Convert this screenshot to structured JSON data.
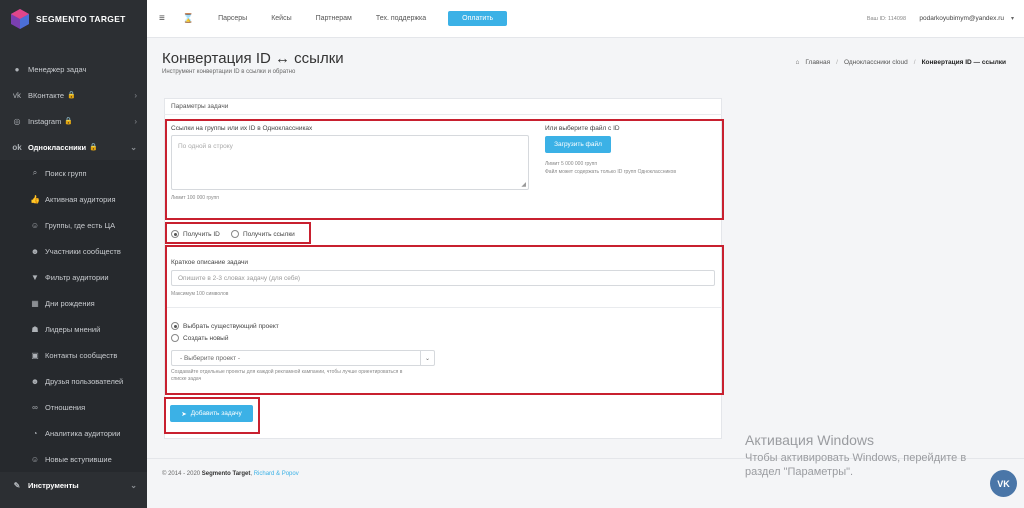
{
  "app": {
    "name": "SEGMENTO TARGET"
  },
  "sidebar": {
    "top": [
      {
        "icon": "map-marker-icon",
        "label": "Менеджер задач"
      },
      {
        "icon": "vk-icon",
        "label": "ВКонтакте"
      },
      {
        "icon": "instagram-icon",
        "label": "Instagram"
      },
      {
        "icon": "odnoklassniki-icon",
        "label": "Одноклассники"
      }
    ],
    "sub": [
      {
        "icon": "search-icon",
        "label": "Поиск групп"
      },
      {
        "icon": "thumbs-up-icon",
        "label": "Активная аудитория"
      },
      {
        "icon": "users-icon",
        "label": "Группы, где есть ЦА"
      },
      {
        "icon": "group-icon",
        "label": "Участники сообществ"
      },
      {
        "icon": "filter-icon",
        "label": "Фильтр аудитории"
      },
      {
        "icon": "calendar-icon",
        "label": "Дни рождения"
      },
      {
        "icon": "leaders-icon",
        "label": "Лидеры мнений"
      },
      {
        "icon": "contacts-icon",
        "label": "Контакты сообществ"
      },
      {
        "icon": "friends-icon",
        "label": "Друзья пользователей"
      },
      {
        "icon": "link-icon",
        "label": "Отношения"
      },
      {
        "icon": "chart-icon",
        "label": "Аналитика аудитории"
      },
      {
        "icon": "new-users-icon",
        "label": "Новые вступившие"
      }
    ],
    "tools": {
      "icon": "wrench-icon",
      "label": "Инструменты"
    }
  },
  "topbar": {
    "menu": [
      "Парсеры",
      "Кейсы",
      "Партнерам",
      "Тех. поддержка"
    ],
    "pay": "Оплатить",
    "user_id": "Ваш ID: 114098",
    "email": "podarkoyubimym@yandex.ru"
  },
  "page": {
    "title": "Конвертация ID ↔ ссылки",
    "subtitle": "Инструмент конвертации ID в ссылки и обратно"
  },
  "breadcrumb": {
    "home": "Главная",
    "mid": "Одноклассники cloud",
    "current": "Конвертация ID — ссылки"
  },
  "form": {
    "panel_title": "Параметры задачи",
    "links_label": "Ссылки на группы или их ID в Одноклассниках",
    "links_placeholder": "По одной в строку",
    "links_limit": "Лимит 100 000 групп",
    "file_label": "Или выберите файл с ID",
    "upload_button": "Загрузить файл",
    "file_limit": "Лимит 5 000 000 групп",
    "file_hint": "Файл может содержать только ID групп Одноклассников",
    "radio_get_id": "Получить ID",
    "radio_get_links": "Получить ссылки",
    "desc_label": "Краткое описание задачи",
    "desc_placeholder": "Опишите в 2-3 словах задачу (для себя)",
    "desc_max": "Максимум 100 символов",
    "project_existing": "Выбрать существующий проект",
    "project_new": "Создать новый",
    "project_select": "- Выберите проект -",
    "project_hint": "Создавайте отдельные проекты для каждой рекламной кампании, чтобы лучше ориентироваться в списке задач",
    "add_button": "Добавить задачу"
  },
  "footer": {
    "text": "© 2014 - 2020",
    "brand": "Segmento Target",
    "sep": ",",
    "author": "Richard & Popov"
  },
  "watermark": {
    "title": "Активация Windows",
    "text": "Чтобы активировать Windows, перейдите в раздел \"Параметры\"."
  },
  "vk_badge": "VK",
  "colors": {
    "accent": "#3bb1e6",
    "sidebar": "#2c2f33",
    "highlight": "#c8202f"
  }
}
